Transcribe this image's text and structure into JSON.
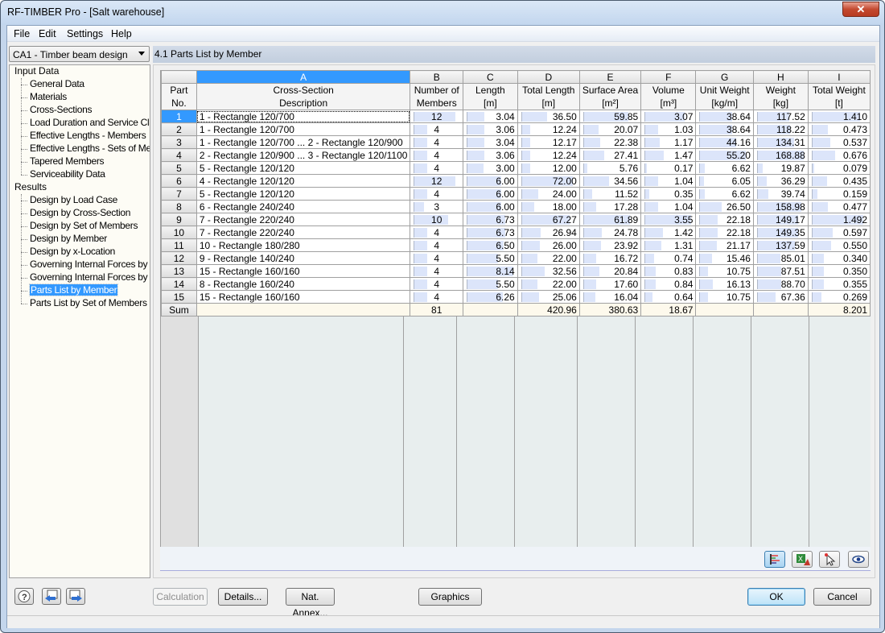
{
  "window": {
    "title": "RF-TIMBER Pro - [Salt warehouse]",
    "close_symbol": "✕"
  },
  "menu": [
    "File",
    "Edit",
    "Settings",
    "Help"
  ],
  "case_selector": {
    "value": "CA1 - Timber beam design"
  },
  "tree": {
    "groups": [
      {
        "label": "Input Data",
        "items": [
          "General Data",
          "Materials",
          "Cross-Sections",
          "Load Duration and Service Clas",
          "Effective Lengths - Members",
          "Effective Lengths - Sets of Mem",
          "Tapered Members",
          "Serviceability Data"
        ]
      },
      {
        "label": "Results",
        "items": [
          "Design by Load Case",
          "Design by Cross-Section",
          "Design by Set of Members",
          "Design by Member",
          "Design by x-Location",
          "Governing Internal Forces by M",
          "Governing Internal Forces by Se",
          "Parts List by Member",
          "Parts List by Set of Members"
        ]
      }
    ],
    "selected": "Parts List by Member",
    "scroll_thumb": "III"
  },
  "panel": {
    "title": "4.1 Parts List by Member"
  },
  "table": {
    "col_letters": [
      "A",
      "B",
      "C",
      "D",
      "E",
      "F",
      "G",
      "H",
      "I"
    ],
    "header_rows": {
      "part_no": [
        "Part",
        "No."
      ],
      "cols": [
        [
          "Cross-Section",
          "Description"
        ],
        [
          "Number of",
          "Members"
        ],
        [
          "Length",
          "[m]"
        ],
        [
          "Total Length",
          "[m]"
        ],
        [
          "Surface Area",
          "[m²]"
        ],
        [
          "Volume",
          "[m³]"
        ],
        [
          "Unit Weight",
          "[kg/m]"
        ],
        [
          "Weight",
          "[kg]"
        ],
        [
          "Total Weight",
          "[t]"
        ]
      ]
    },
    "rows": [
      {
        "no": "1",
        "desc": "1 - Rectangle 120/700",
        "members": "12",
        "length": "3.04",
        "total_length": "36.50",
        "surface": "59.85",
        "volume": "3.07",
        "unit_weight": "38.64",
        "weight": "117.52",
        "total_weight": "1.410"
      },
      {
        "no": "2",
        "desc": "1 - Rectangle 120/700",
        "members": "4",
        "length": "3.06",
        "total_length": "12.24",
        "surface": "20.07",
        "volume": "1.03",
        "unit_weight": "38.64",
        "weight": "118.22",
        "total_weight": "0.473"
      },
      {
        "no": "3",
        "desc": "1 - Rectangle 120/700 ... 2 - Rectangle 120/900",
        "members": "4",
        "length": "3.04",
        "total_length": "12.17",
        "surface": "22.38",
        "volume": "1.17",
        "unit_weight": "44.16",
        "weight": "134.31",
        "total_weight": "0.537"
      },
      {
        "no": "4",
        "desc": "2 - Rectangle 120/900 ... 3 - Rectangle 120/1100",
        "members": "4",
        "length": "3.06",
        "total_length": "12.24",
        "surface": "27.41",
        "volume": "1.47",
        "unit_weight": "55.20",
        "weight": "168.88",
        "total_weight": "0.676"
      },
      {
        "no": "5",
        "desc": "5 - Rectangle 120/120",
        "members": "4",
        "length": "3.00",
        "total_length": "12.00",
        "surface": "5.76",
        "volume": "0.17",
        "unit_weight": "6.62",
        "weight": "19.87",
        "total_weight": "0.079"
      },
      {
        "no": "6",
        "desc": "4 - Rectangle 120/120",
        "members": "12",
        "length": "6.00",
        "total_length": "72.00",
        "surface": "34.56",
        "volume": "1.04",
        "unit_weight": "6.05",
        "weight": "36.29",
        "total_weight": "0.435"
      },
      {
        "no": "7",
        "desc": "5 - Rectangle 120/120",
        "members": "4",
        "length": "6.00",
        "total_length": "24.00",
        "surface": "11.52",
        "volume": "0.35",
        "unit_weight": "6.62",
        "weight": "39.74",
        "total_weight": "0.159"
      },
      {
        "no": "8",
        "desc": "6 - Rectangle 240/240",
        "members": "3",
        "length": "6.00",
        "total_length": "18.00",
        "surface": "17.28",
        "volume": "1.04",
        "unit_weight": "26.50",
        "weight": "158.98",
        "total_weight": "0.477"
      },
      {
        "no": "9",
        "desc": "7 - Rectangle 220/240",
        "members": "10",
        "length": "6.73",
        "total_length": "67.27",
        "surface": "61.89",
        "volume": "3.55",
        "unit_weight": "22.18",
        "weight": "149.17",
        "total_weight": "1.492"
      },
      {
        "no": "10",
        "desc": "7 - Rectangle 220/240",
        "members": "4",
        "length": "6.73",
        "total_length": "26.94",
        "surface": "24.78",
        "volume": "1.42",
        "unit_weight": "22.18",
        "weight": "149.35",
        "total_weight": "0.597"
      },
      {
        "no": "11",
        "desc": "10 - Rectangle 180/280",
        "members": "4",
        "length": "6.50",
        "total_length": "26.00",
        "surface": "23.92",
        "volume": "1.31",
        "unit_weight": "21.17",
        "weight": "137.59",
        "total_weight": "0.550"
      },
      {
        "no": "12",
        "desc": "9 - Rectangle 140/240",
        "members": "4",
        "length": "5.50",
        "total_length": "22.00",
        "surface": "16.72",
        "volume": "0.74",
        "unit_weight": "15.46",
        "weight": "85.01",
        "total_weight": "0.340"
      },
      {
        "no": "13",
        "desc": "15 - Rectangle 160/160",
        "members": "4",
        "length": "8.14",
        "total_length": "32.56",
        "surface": "20.84",
        "volume": "0.83",
        "unit_weight": "10.75",
        "weight": "87.51",
        "total_weight": "0.350"
      },
      {
        "no": "14",
        "desc": "8 - Rectangle 160/240",
        "members": "4",
        "length": "5.50",
        "total_length": "22.00",
        "surface": "17.60",
        "volume": "0.84",
        "unit_weight": "16.13",
        "weight": "88.70",
        "total_weight": "0.355"
      },
      {
        "no": "15",
        "desc": "15 - Rectangle 160/160",
        "members": "4",
        "length": "6.26",
        "total_length": "25.06",
        "surface": "16.04",
        "volume": "0.64",
        "unit_weight": "10.75",
        "weight": "67.36",
        "total_weight": "0.269"
      }
    ],
    "sum": {
      "no": "Sum",
      "desc": "",
      "members": "81",
      "length": "",
      "total_length": "420.96",
      "surface": "380.63",
      "volume": "18.67",
      "unit_weight": "",
      "weight": "",
      "total_weight": "8.201"
    },
    "bar_color": "#dce5fa",
    "selection_color": "#3399ff"
  },
  "grid_toolbar": {
    "icons": [
      "bar-chart-icon",
      "excel-export-icon",
      "pick-cursor-icon",
      "eye-icon"
    ]
  },
  "buttons": {
    "calculation": "Calculation",
    "details": "Details...",
    "nat_annex": "Nat. Annex...",
    "graphics": "Graphics",
    "ok": "OK",
    "cancel": "Cancel"
  }
}
